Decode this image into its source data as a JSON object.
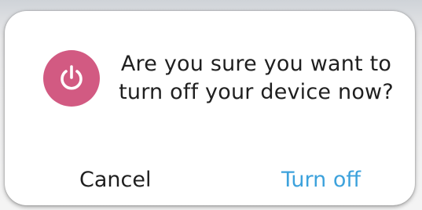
{
  "dialog": {
    "icon": "power-icon",
    "icon_color": "#d25a82",
    "message": "Are you sure you want to\nturn off your device now?",
    "cancel_label": "Cancel",
    "confirm_label": "Turn off",
    "confirm_color": "#3da2dc"
  }
}
